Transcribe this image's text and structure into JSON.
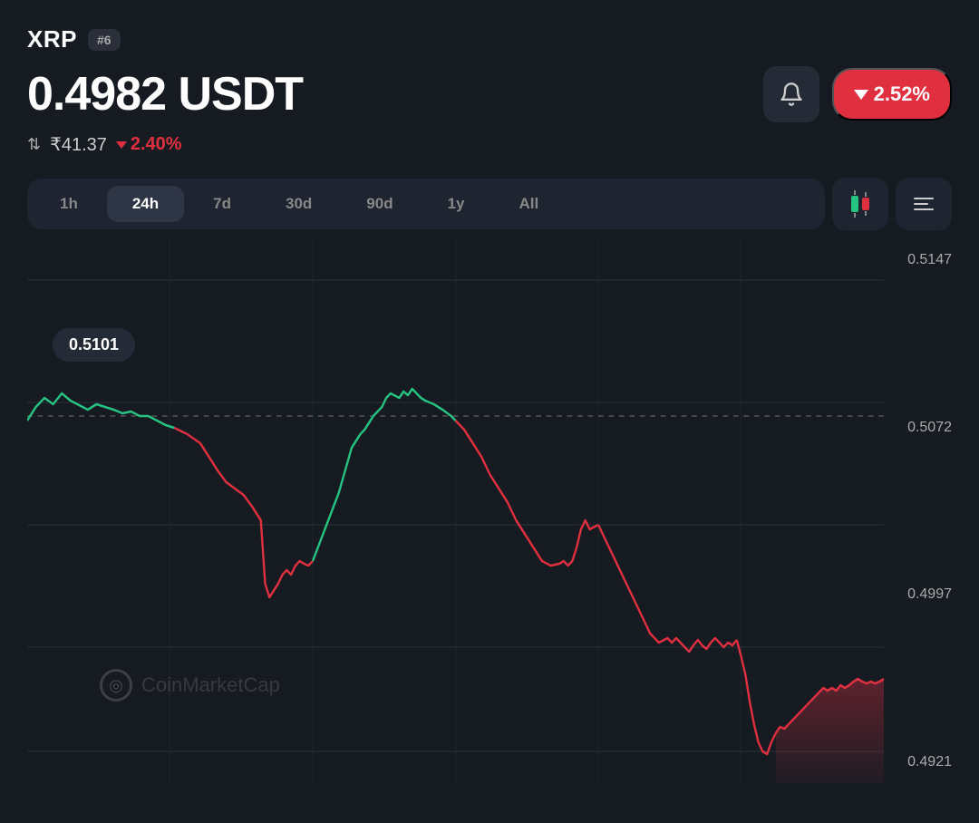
{
  "header": {
    "coin": "XRP",
    "rank": "#6",
    "price": "0.4982 USDT",
    "inr_value": "₹41.37",
    "inr_change": "2.40%",
    "percent_change": "2.52%",
    "bell_icon": "🔔"
  },
  "timeframes": [
    {
      "label": "1h",
      "active": false
    },
    {
      "label": "24h",
      "active": true
    },
    {
      "label": "7d",
      "active": false
    },
    {
      "label": "30d",
      "active": false
    },
    {
      "label": "90d",
      "active": false
    },
    {
      "label": "1y",
      "active": false
    },
    {
      "label": "All",
      "active": false
    }
  ],
  "chart": {
    "y_labels": [
      "0.5147",
      "0.5072",
      "0.4997",
      "0.4921"
    ],
    "price_tooltip": "0.5101",
    "watermark": "CoinMarketCap"
  }
}
